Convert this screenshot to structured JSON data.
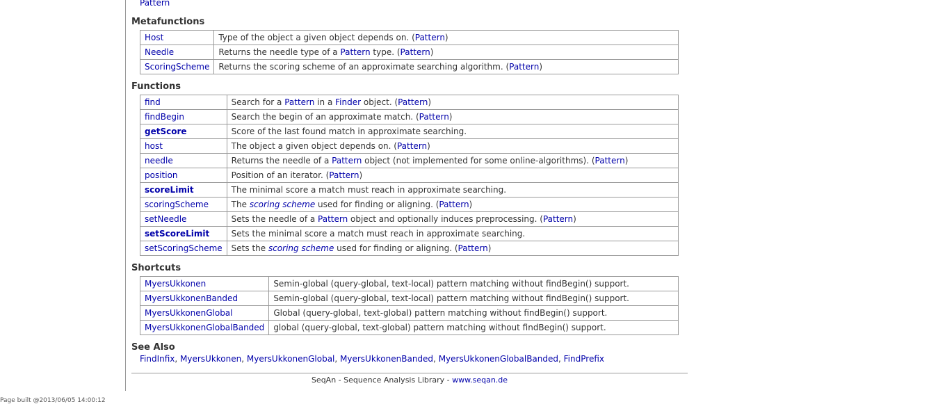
{
  "top_link": "Pattern",
  "metafunctions": {
    "heading": "Metafunctions",
    "rows": [
      {
        "name": "Host",
        "desc": [
          {
            "t": "Type of the object a given object depends on. ("
          },
          {
            "t": "Pattern",
            "link": true
          },
          {
            "t": ")"
          }
        ]
      },
      {
        "name": "Needle",
        "desc": [
          {
            "t": "Returns the needle type of a "
          },
          {
            "t": "Pattern",
            "link": true
          },
          {
            "t": " type. ("
          },
          {
            "t": "Pattern",
            "link": true
          },
          {
            "t": ")"
          }
        ]
      },
      {
        "name": "ScoringScheme",
        "desc": [
          {
            "t": "Returns the scoring scheme of an approximate searching algorithm. ("
          },
          {
            "t": "Pattern",
            "link": true
          },
          {
            "t": ")"
          }
        ]
      }
    ]
  },
  "functions": {
    "heading": "Functions",
    "rows": [
      {
        "name": "find",
        "desc": [
          {
            "t": "Search for a "
          },
          {
            "t": "Pattern",
            "link": true
          },
          {
            "t": " in a "
          },
          {
            "t": "Finder",
            "link": true
          },
          {
            "t": " object. ("
          },
          {
            "t": "Pattern",
            "link": true
          },
          {
            "t": ")"
          }
        ]
      },
      {
        "name": "findBegin",
        "desc": [
          {
            "t": "Search the begin of an approximate match. ("
          },
          {
            "t": "Pattern",
            "link": true
          },
          {
            "t": ")"
          }
        ]
      },
      {
        "name": "getScore",
        "bold": true,
        "desc": [
          {
            "t": "Score of the last found match in approximate searching."
          }
        ]
      },
      {
        "name": "host",
        "desc": [
          {
            "t": "The object a given object depends on. ("
          },
          {
            "t": "Pattern",
            "link": true
          },
          {
            "t": ")"
          }
        ]
      },
      {
        "name": "needle",
        "desc": [
          {
            "t": "Returns the needle of a "
          },
          {
            "t": "Pattern",
            "link": true
          },
          {
            "t": " object (not implemented for some online-algorithms). ("
          },
          {
            "t": "Pattern",
            "link": true
          },
          {
            "t": ")"
          }
        ]
      },
      {
        "name": "position",
        "desc": [
          {
            "t": "Position of an iterator. ("
          },
          {
            "t": "Pattern",
            "link": true
          },
          {
            "t": ")"
          }
        ]
      },
      {
        "name": "scoreLimit",
        "bold": true,
        "desc": [
          {
            "t": "The minimal score a match must reach in approximate searching."
          }
        ]
      },
      {
        "name": "scoringScheme",
        "desc": [
          {
            "t": "The "
          },
          {
            "t": "scoring scheme",
            "link": true,
            "italic": true
          },
          {
            "t": " used for finding or aligning. ("
          },
          {
            "t": "Pattern",
            "link": true
          },
          {
            "t": ")"
          }
        ]
      },
      {
        "name": "setNeedle",
        "desc": [
          {
            "t": "Sets the needle of a "
          },
          {
            "t": "Pattern",
            "link": true
          },
          {
            "t": " object and optionally induces preprocessing. ("
          },
          {
            "t": "Pattern",
            "link": true
          },
          {
            "t": ")"
          }
        ]
      },
      {
        "name": "setScoreLimit",
        "bold": true,
        "desc": [
          {
            "t": "Sets the minimal score a match must reach in approximate searching."
          }
        ]
      },
      {
        "name": "setScoringScheme",
        "desc": [
          {
            "t": "Sets the "
          },
          {
            "t": "scoring scheme",
            "link": true,
            "italic": true
          },
          {
            "t": " used for finding or aligning. ("
          },
          {
            "t": "Pattern",
            "link": true
          },
          {
            "t": ")"
          }
        ]
      }
    ]
  },
  "shortcuts": {
    "heading": "Shortcuts",
    "rows": [
      {
        "name": "MyersUkkonen",
        "desc": [
          {
            "t": "Semin-global (query-global, text-local) pattern matching without findBegin() support."
          }
        ]
      },
      {
        "name": "MyersUkkonenBanded",
        "desc": [
          {
            "t": "Semin-global (query-global, text-local) pattern matching without findBegin() support."
          }
        ]
      },
      {
        "name": "MyersUkkonenGlobal",
        "desc": [
          {
            "t": "Global (query-global, text-global) pattern matching without findBegin() support."
          }
        ]
      },
      {
        "name": "MyersUkkonenGlobalBanded",
        "desc": [
          {
            "t": "global (query-global, text-global) pattern matching without findBegin() support."
          }
        ]
      }
    ]
  },
  "see_also": {
    "heading": "See Also",
    "links": [
      "FindInfix",
      "MyersUkkonen",
      "MyersUkkonenGlobal",
      "MyersUkkonenBanded",
      "MyersUkkonenGlobalBanded",
      "FindPrefix"
    ]
  },
  "footer": {
    "text": "SeqAn - Sequence Analysis Library - ",
    "link": "www.seqan.de"
  },
  "page_built": "Page built @2013/06/05 14:00:12",
  "colors": {
    "link": "#0000aa",
    "text": "#333333",
    "border": "#999999"
  }
}
